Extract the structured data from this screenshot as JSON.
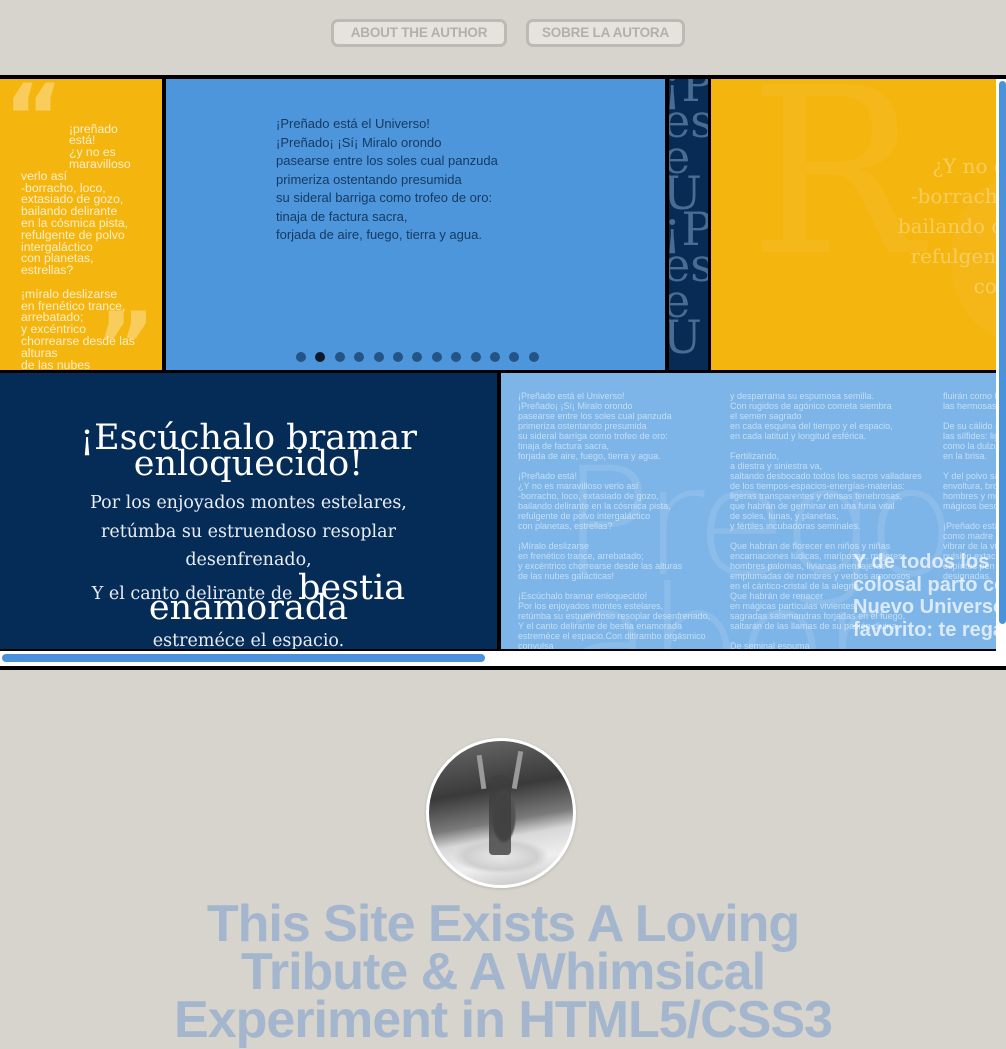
{
  "nav": {
    "about_label": "ABOUT THE AUTHOR",
    "sobre_label": "SOBRE LA AUTORA"
  },
  "colors": {
    "yellow": "#f5b50f",
    "blue": "#4d96dc",
    "navy": "#052b57",
    "light_blue": "#7eb5e8",
    "page_bg": "#d7d3cd",
    "headline": "#a3b6cd"
  },
  "panel_yellow1": {
    "quote_open": "“",
    "quote_close": "”",
    "text": "¡preñado\nestá!\n¿y no es\nmaravilloso",
    "text2": "verlo así\n-borracho, loco,\nextasiado de gozo,\nbailando delirante\nen la cósmica pista,\nrefulgente de polvo\nintergaláctico\ncon planetas,\nestrellas?\n\n¡míralo deslizarse\nen frenético trance,\narrebatado;\ny excéntrico\nchorrearse desde las\nalturas\nde las nubes\ngalácticas!"
  },
  "panel_blue1": {
    "poem": "¡Preñado está el Universo!\n¡Preñado¡ ¡Sí¡ Miralo orondo\npasearse entre los soles cual panzuda\nprimeriza ostentando presumida\nsu sideral barriga como trofeo de oro:\ntinaja de factura sacra,\nforjada de aire, fuego, tierra y agua.",
    "slides_total": 13,
    "active_slide": 2
  },
  "panel_strip": {
    "letters": "¡P\nes\ne\nU\n¡P\nes\ne\nU"
  },
  "panel_yellow2": {
    "watermark": "R",
    "text": "¿Y no es\n-borracho,\nbailando de\nrefulgente\ncon "
  },
  "panel_navy": {
    "heading_line1": "¡Escúchalo bramar",
    "heading_line2": "enloquecido!",
    "line1": "Por los enjoyados montes estelares,",
    "line2": "retúmba su estruendoso resoplar",
    "line3": "desenfrenado,",
    "line4_prefix": "Y el canto delirante de ",
    "line4_big": "bestia",
    "heading_line3": "enamorada",
    "line5": "estreméce el espacio."
  },
  "panel_light": {
    "watermark": "Prego\nabor",
    "col1": "¡Preñado está el Universo!\n¡Preñado¡ ¡Sí¡ Miralo orondo\npasearse entre los soles cual panzuda\nprimeriza ostentando presumida\nsu sideral barriga como trofeo de oro:\ntinaja de factura sacra,\nforjada de aire, fuego, tierra y agua.\n\n¡Preñado está!\n¿Y no es maravilloso verlo así\n-borracho, loco, extasiado de gozo,\nbailando delirante en la cósmica pista,\nrefulgente de polvo intergaláctico\ncon planetas, estrellas?\n\n¡Míralo deslizarse\nen frenético trance, arrebatado;\ny excéntrico chorrearse desde las alturas\nde las nubes galácticas!\n\n¡Escúchalo bramar enloquecido!\nPor los enjoyados montes estelares,\nretúmba su estruendoso resoplar desenfrenado,\nY el canto delirante de bestia enamorada\nestreméce el espacio.Con ditirambo orgásmico\nconvulsa",
    "col2": "y desparrama su espumosa semilla.\nCon rugidos de agónico cometa siembra\nel semen sagrado\nen cada esquina del tiempo y el espacio,\nen cada latitud y longitud esférica.\n\nFertilizando,\na diestra y siniestra va,\nsaltando desbocado todos los sacros valladares\nde los tiempos-espacios-energías-materias:\nligeras transparentes y densas tenebrosas,\nque habrán de germinar en una furia vital\nde soles, lunas, y planetas,\ny fértiles incubadoras seminales.\n\nQue habrán de florecer en niños y niñas\nencarnaciones lúdicas, mariposas, mujeres,\nhombres palomas, livianas mensajeras\nemplumadas de nombres y verbos amorosos\nen el cántico-cristal de la alegría.\nQue habrán de renacer\nen mágicas partículas vivientes,\nsagradas salamandras forjadas en el fuego,\nsaltarán de las llamas de su pasión divina.\n\nDe seminal espuma",
    "col3": "fluirán como f\nlas hermosas \n\nDe su cálido a\nlas sílfides: lig\ncomo la dulzu\nen la brisa.\n\nY del polvo sa\nenvoltura, bro\nhombres y mu\nmágicos beso\n\n¡Preñado está\ncomo madre r\nvibrar de la vid\npulsión extac\nespíritus pen\ndesignadas.",
    "big_text": "Y de todos los h\ncolosal parto có\nNuevo Universo\nfavorito: te rega"
  },
  "scroll": {
    "horizontal_visible_fraction": 0.48,
    "vertical_visible_fraction": 0.95
  },
  "profile": {
    "avatar_alt": "Black and white photo of the author dancing"
  },
  "headline": {
    "line1": "This Site Exists A Loving",
    "line2": "Tribute & A Whimsical",
    "line3": "Experiment in HTML5/CSS3"
  }
}
